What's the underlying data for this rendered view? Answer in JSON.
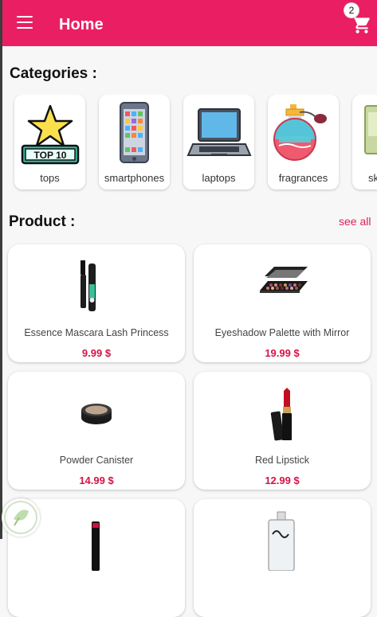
{
  "appbar": {
    "title": "Home",
    "cart_count": "2",
    "color": "#ea1f63"
  },
  "categories": {
    "heading": "Categories :",
    "items": [
      {
        "label": "tops",
        "icon": "top10-star-icon"
      },
      {
        "label": "smartphones",
        "icon": "smartphone-icon"
      },
      {
        "label": "laptops",
        "icon": "laptop-icon"
      },
      {
        "label": "fragrances",
        "icon": "perfume-bottle-icon"
      },
      {
        "label": "sk",
        "icon": "skincare-tube-icon"
      }
    ]
  },
  "products": {
    "heading": "Product :",
    "see_all": "see all",
    "items": [
      {
        "name": "Essence Mascara Lash Princess",
        "price": "9.99 $"
      },
      {
        "name": "Eyeshadow Palette with Mirror",
        "price": "19.99 $"
      },
      {
        "name": "Powder Canister",
        "price": "14.99 $"
      },
      {
        "name": "Red Lipstick",
        "price": "12.99 $"
      },
      {
        "name": "",
        "price": ""
      },
      {
        "name": "",
        "price": ""
      }
    ]
  },
  "price_color": "#d41446"
}
